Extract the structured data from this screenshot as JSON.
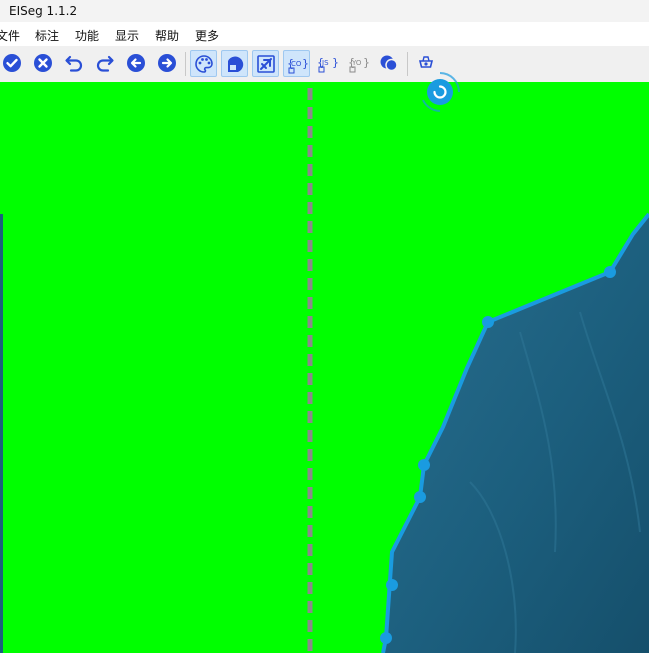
{
  "window": {
    "title": "EISeg 1.1.2"
  },
  "menu": {
    "items": [
      "文件",
      "标注",
      "功能",
      "显示",
      "帮助",
      "更多"
    ]
  },
  "toolbar": {
    "buttons": [
      {
        "name": "finish-icon",
        "tooltip": ""
      },
      {
        "name": "clear-icon",
        "tooltip": ""
      },
      {
        "name": "undo-icon",
        "tooltip": ""
      },
      {
        "name": "redo-icon",
        "tooltip": ""
      },
      {
        "name": "prev-image-icon",
        "tooltip": ""
      },
      {
        "name": "next-image-icon",
        "tooltip": ""
      },
      {
        "name": "palette-icon",
        "checked": true
      },
      {
        "name": "save-mask-icon",
        "checked": true
      },
      {
        "name": "save-pseudo-icon",
        "checked": true
      },
      {
        "name": "save-coco-icon",
        "checked": true,
        "text": "CO"
      },
      {
        "name": "save-json-icon",
        "checked": false,
        "text": "JS"
      },
      {
        "name": "save-yolo-icon",
        "checked": false,
        "text": "YO"
      },
      {
        "name": "grid-toggle-icon",
        "checked": false
      },
      {
        "name": "ai-model-icon",
        "checked": false
      }
    ]
  },
  "colors": {
    "mask_background": "#00ff00",
    "object_fill": "#1c5f7e",
    "polygon_stroke": "#1a9be0",
    "guide_line": "#8a8a8a",
    "accent_icon": "#2a4fd6"
  },
  "status": {
    "loading": true
  }
}
